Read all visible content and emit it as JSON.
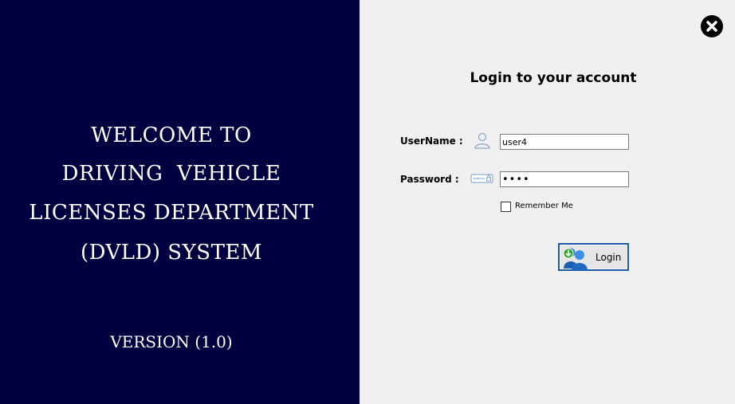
{
  "welcome": {
    "line1": "WELCOME TO",
    "line2": "DRIVING  VEHICLE",
    "line3": "LICENSES DEPARTMENT",
    "line4": "(DVLD) SYSTEM",
    "version": "VERSION (1.0)"
  },
  "login": {
    "title": "Login to your account",
    "username_label": "UserName :",
    "username_value": "user4",
    "password_label": "Password :",
    "password_value": "1234",
    "remember_label": "Remember Me",
    "remember_checked": false,
    "button_label": "Login"
  },
  "icons": {
    "close": "close-icon",
    "user": "user-icon",
    "password": "password-icon",
    "login": "users-login-icon"
  },
  "colors": {
    "left_panel": "#000040",
    "right_panel": "#f0f0f0",
    "button_border": "#1e5aa8"
  }
}
